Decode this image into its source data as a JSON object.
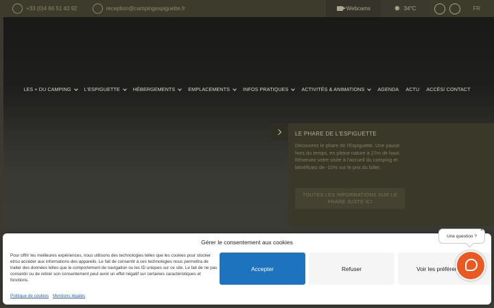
{
  "topbar": {
    "phone": "+33 (0)4 66 51 43 92",
    "email": "reception@campingespiguette.fr",
    "webcams": "Webcams",
    "temperature": "34°C",
    "language": "FR"
  },
  "nav": {
    "items": [
      {
        "label": "LES + DU CAMPING",
        "dropdown": true
      },
      {
        "label": "L'ESPIGUETTE",
        "dropdown": true
      },
      {
        "label": "HÉBERGEMENTS",
        "dropdown": true
      },
      {
        "label": "EMPLACEMENTS",
        "dropdown": true
      },
      {
        "label": "INFOS PRATIQUES",
        "dropdown": true
      },
      {
        "label": "ACTIVITÉS & ANIMATIONS",
        "dropdown": true
      },
      {
        "label": "AGENDA",
        "dropdown": false
      },
      {
        "label": "ACTU",
        "dropdown": false
      },
      {
        "label": "ACCÈS/ CONTACT",
        "dropdown": false
      }
    ]
  },
  "panel": {
    "title": "LE PHARE DE L'ESPIGUETTE",
    "text1": "Découvrez le phare de l'Espiguette. Une pause hors du temps, en pleine nature à 27m de haut.",
    "text2": "Réservez votre visite à l'accueil du camping et bénéficiez de -10% sur le prix du billet.",
    "cta": "TOUTES LES INFORMATIONS SUR LE PHARE JUSTE ICI"
  },
  "chat": {
    "bubble": "Une question ?",
    "close": "×"
  },
  "cookie": {
    "title": "Gérer le consentement aux cookies",
    "description": "Pour offrir les meilleures expériences, nous utilisons des technologies telles que les cookies pour stocker et/ou accéder aux informations des appareils. Le fait de consentir à ces technologies nous permettra de traiter des données telles que le comportement de navigation ou les ID uniques sur ce site. Le fait de ne pas consentir ou de retirer son consentement peut avoir un effet négatif sur certaines caractéristiques et fonctions.",
    "accept": "Accepter",
    "refuse": "Refuser",
    "preferences": "Voir les préférences",
    "policy_link": "Politique de cookies",
    "legal_link": "Mentions légales"
  },
  "colors": {
    "topbar": "#3d3b2c",
    "accent_blue": "#1e73be",
    "chat_orange": "#e85a22"
  },
  "icons": [
    "phone-icon",
    "email-icon",
    "camera-icon",
    "sun-icon",
    "facebook-icon",
    "instagram-icon",
    "chevron-right-icon",
    "chat-icon",
    "close-icon"
  ]
}
